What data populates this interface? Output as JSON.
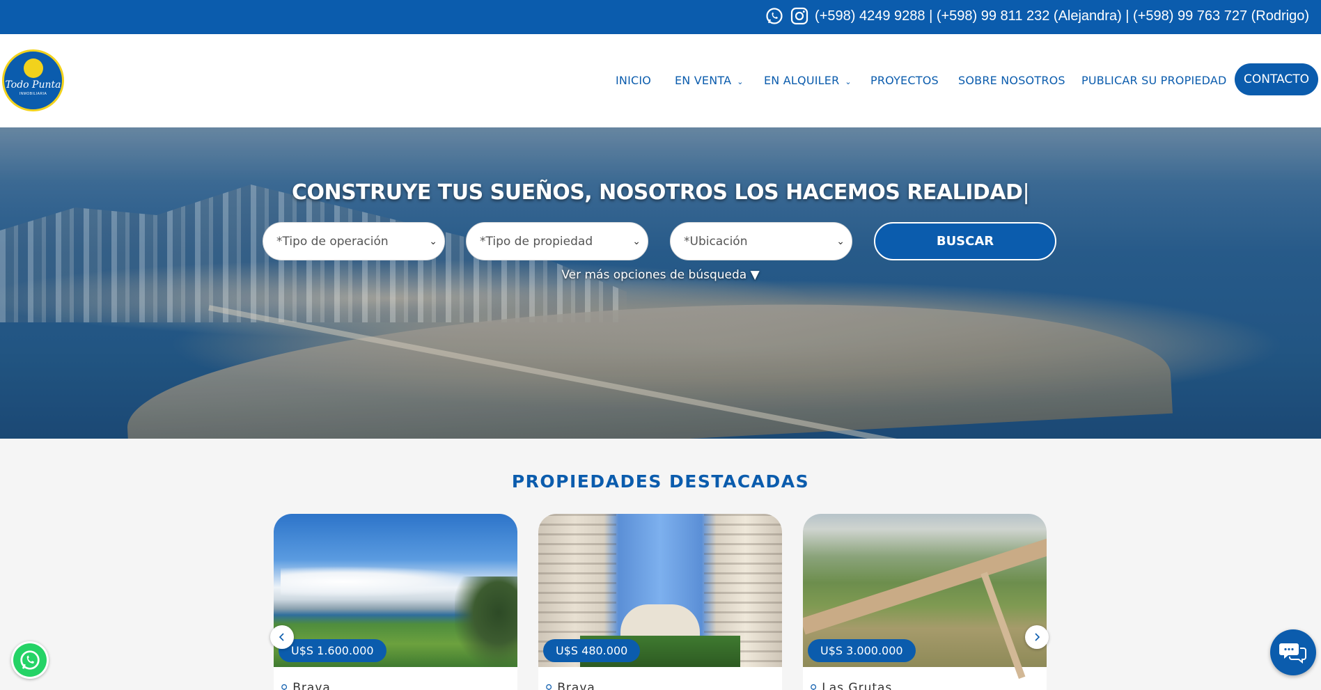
{
  "topbar": {
    "phones": "(+598) 4249 9288  | (+598) 99 811 232 (Alejandra) | (+598) 99 763 727 (Rodrigo)",
    "icons": [
      "whatsapp-icon",
      "instagram-icon"
    ]
  },
  "logo": {
    "brand": "Todo Punta",
    "tagline": "INMOBILIARIA"
  },
  "nav": {
    "items": [
      {
        "label": "INICIO",
        "dropdown": false
      },
      {
        "label": "EN VENTA",
        "dropdown": true
      },
      {
        "label": "EN ALQUILER",
        "dropdown": true
      },
      {
        "label": "PROYECTOS",
        "dropdown": false
      },
      {
        "label": "SOBRE NOSOTROS",
        "dropdown": false
      },
      {
        "label": "PUBLICAR SU PROPIEDAD",
        "dropdown": false
      }
    ],
    "contact_label": "CONTACTO"
  },
  "hero": {
    "title": "CONSTRUYE TUS SUEÑOS, NOSOTROS LOS HACEMOS REALIDAD",
    "cursor": "|",
    "search": {
      "operation_placeholder": "*Tipo de operación",
      "property_placeholder": "*Tipo de propiedad",
      "location_placeholder": "*Ubicación",
      "button_label": "BUSCAR",
      "more_options": "Ver más opciones de búsqueda ▼"
    }
  },
  "featured": {
    "title": "PROPIEDADES DESTACADAS",
    "cards": [
      {
        "price": "U$S 1.600.000",
        "location": "Brava"
      },
      {
        "price": "U$S 480.000",
        "location": "Brava"
      },
      {
        "price": "U$S 3.000.000",
        "location": "Las Grutas"
      }
    ]
  },
  "colors": {
    "brand_blue": "#0b5cad",
    "logo_yellow": "#f2d21c",
    "whatsapp_green": "#25d366"
  }
}
